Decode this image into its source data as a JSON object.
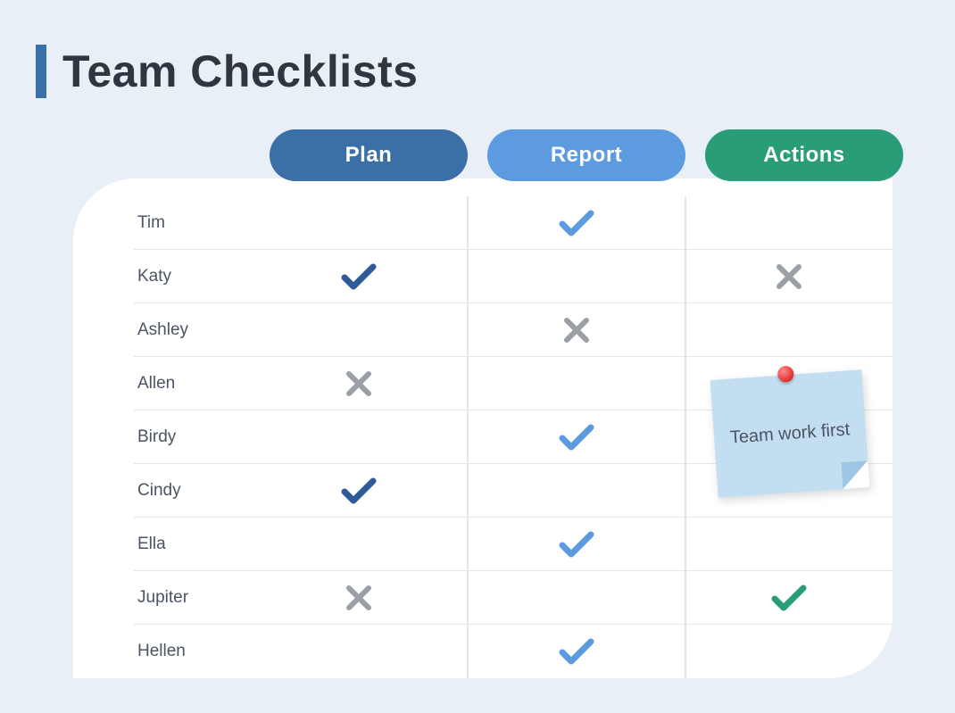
{
  "title": "Team Checklists",
  "columns": {
    "plan": "Plan",
    "report": "Report",
    "actions": "Actions"
  },
  "colors": {
    "plan_pill": "#3b6fa8",
    "report_pill": "#5d9be0",
    "actions_pill": "#299d78",
    "check_dark": "#2d5a99",
    "check_blue": "#5d9be0",
    "check_green": "#299d78",
    "cross_gray": "#9aa0a6"
  },
  "rows": [
    {
      "name": "Tim",
      "plan": "",
      "report": "check-blue",
      "actions": ""
    },
    {
      "name": "Katy",
      "plan": "check-dark",
      "report": "",
      "actions": "cross-gray"
    },
    {
      "name": "Ashley",
      "plan": "",
      "report": "cross-gray",
      "actions": ""
    },
    {
      "name": "Allen",
      "plan": "cross-gray",
      "report": "",
      "actions": ""
    },
    {
      "name": "Birdy",
      "plan": "",
      "report": "check-blue",
      "actions": ""
    },
    {
      "name": "Cindy",
      "plan": "check-dark",
      "report": "",
      "actions": ""
    },
    {
      "name": "Ella",
      "plan": "",
      "report": "check-blue",
      "actions": ""
    },
    {
      "name": "Jupiter",
      "plan": "cross-gray",
      "report": "",
      "actions": "check-green"
    },
    {
      "name": "Hellen",
      "plan": "",
      "report": "check-blue",
      "actions": ""
    }
  ],
  "note": {
    "text": "Team work first"
  }
}
